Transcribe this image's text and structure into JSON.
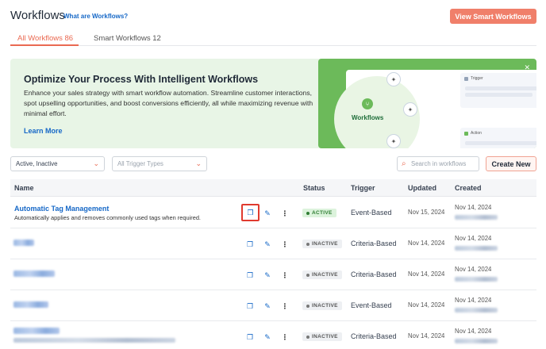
{
  "header": {
    "title": "Workflows",
    "help_link": "What are Workflows?",
    "smart_button": "View Smart Workflows"
  },
  "tabs": [
    {
      "label": "All Workflows 86",
      "active": true
    },
    {
      "label": "Smart Workflows 12",
      "active": false
    }
  ],
  "banner": {
    "title": "Optimize Your Process With Intelligent Workflows",
    "description": "Enhance your sales strategy with smart workflow automation. Streamline customer interactions, spot upselling opportunities, and boost conversions efficiently, all while maximizing revenue with minimal effort.",
    "link": "Learn More",
    "art_label": "Workflows",
    "trigger_label": "Trigger",
    "action_label": "Action",
    "close_icon": "close-icon"
  },
  "filters": {
    "status_value": "Active, Inactive",
    "trigger_placeholder": "All Trigger Types",
    "search_placeholder": "Search in workflows",
    "create_button": "Create New"
  },
  "table": {
    "columns": [
      "Name",
      "Status",
      "Trigger",
      "Updated",
      "Created"
    ],
    "rows": [
      {
        "name": "Automatic Tag Management",
        "description": "Automatically applies and removes commonly used tags when required.",
        "status": "ACTIVE",
        "trigger": "Event-Based",
        "updated": "Nov 15, 2024",
        "created": "Nov 14, 2024"
      },
      {
        "name": "",
        "description": "",
        "status": "INACTIVE",
        "trigger": "Criteria-Based",
        "updated": "Nov 14, 2024",
        "created": "Nov 14, 2024"
      },
      {
        "name": "",
        "description": "",
        "status": "INACTIVE",
        "trigger": "Criteria-Based",
        "updated": "Nov 14, 2024",
        "created": "Nov 14, 2024"
      },
      {
        "name": "",
        "description": "",
        "status": "INACTIVE",
        "trigger": "Event-Based",
        "updated": "Nov 14, 2024",
        "created": "Nov 14, 2024"
      },
      {
        "name": "",
        "description": "",
        "status": "INACTIVE",
        "trigger": "Criteria-Based",
        "updated": "Nov 14, 2024",
        "created": "Nov 14, 2024"
      }
    ]
  },
  "colors": {
    "accent": "#ea6a52",
    "link": "#1668c7",
    "active_badge": "#2e7d32",
    "banner_bg": "#e8f5e6",
    "banner_art": "#6cba5a"
  }
}
